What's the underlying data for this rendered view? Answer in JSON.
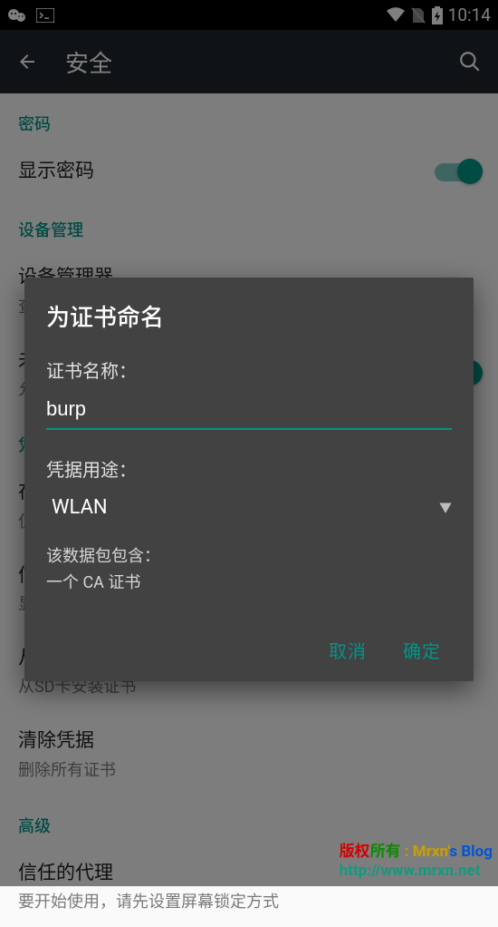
{
  "status": {
    "time": "10:14"
  },
  "appbar": {
    "title": "安全"
  },
  "sections": {
    "password": {
      "header": "密码",
      "show_password": "显示密码"
    },
    "device_admin": {
      "header": "设备管理",
      "item_title": "设备管理器",
      "item_sub": "查看或停用设备管理器"
    },
    "unknown": {
      "item_title": "未",
      "item_sub": "允"
    },
    "credstore": {
      "header": "凭",
      "storage_title": "存",
      "storage_sub": "仅",
      "trusted_title": "信",
      "trusted_sub": "显",
      "install_title": "从",
      "install_sub": "从SD卡安装证书",
      "clear_title": "清除凭据",
      "clear_sub": "删除所有证书"
    },
    "advanced": {
      "header": "高级",
      "trust_title": "信任的代理",
      "trust_sub": "要开始使用，请先设置屏幕锁定方式"
    }
  },
  "dialog": {
    "title": "为证书命名",
    "name_label": "证书名称：",
    "name_value": "burp",
    "use_label": "凭据用途：",
    "use_value": "WLAN",
    "info1": "该数据包包含：",
    "info2": "一个 CA 证书",
    "cancel": "取消",
    "ok": "确定"
  },
  "watermark": {
    "line1_a": "版权",
    "line1_b": "所有",
    "line1_c": " : Mrxn'",
    "line1_d": "s Blog",
    "line2": "http://www.mrxn.net"
  }
}
